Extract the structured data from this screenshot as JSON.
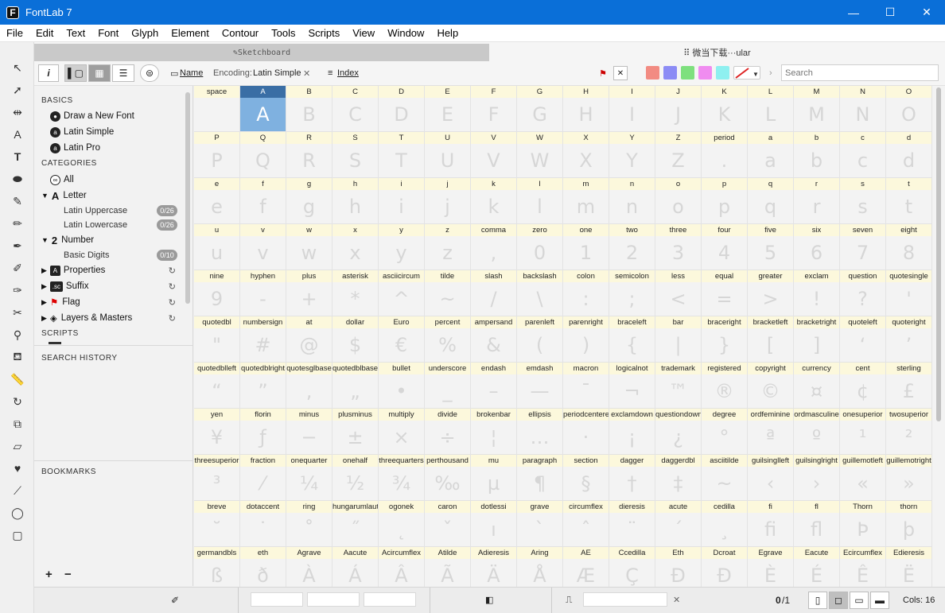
{
  "window": {
    "title": "FontLab 7",
    "controls": [
      "—",
      "☐",
      "✕"
    ]
  },
  "menu": [
    "File",
    "Edit",
    "Text",
    "Font",
    "Glyph",
    "Element",
    "Contour",
    "Tools",
    "Scripts",
    "View",
    "Window",
    "Help"
  ],
  "tabs": {
    "sketchboard": "✎Sketchboard",
    "font": "⠿ 微当下载···ular"
  },
  "toolbar": {
    "info": "i",
    "name_label": "Name",
    "encoding_label": "Encoding:",
    "encoding_value": "Latin Simple",
    "clear": "✕",
    "index_label": "Index",
    "search_placeholder": "Search",
    "color_swatches": [
      "#f28b82",
      "#8c8cf5",
      "#7ee07e",
      "#f08cf0",
      "#8ef0f0"
    ]
  },
  "sidebar": {
    "basics_header": "BASICS",
    "basics": [
      "Draw a New Font",
      "Latin Simple",
      "Latin Pro"
    ],
    "categories_header": "CATEGORIES",
    "all": "All",
    "letter": "Letter",
    "latin_upper": "Latin Uppercase",
    "latin_upper_badge": "0/26",
    "latin_lower": "Latin Lowercase",
    "latin_lower_badge": "0/26",
    "number": "Number",
    "basic_digits": "Basic Digits",
    "basic_digits_badge": "0/10",
    "properties": "Properties",
    "suffix": "Suffix",
    "flag": "Flag",
    "layers": "Layers & Masters",
    "scripts_header": "SCRIPTS",
    "search_history": "SEARCH HISTORY",
    "bookmarks": "BOOKMARKS",
    "add": "+",
    "remove": "−"
  },
  "status": {
    "count": "0",
    "total": "/1",
    "cols": "Cols: 16"
  },
  "glyph_rows": [
    [
      [
        "space",
        ""
      ],
      [
        "A",
        "A"
      ],
      [
        "B",
        "B"
      ],
      [
        "C",
        "C"
      ],
      [
        "D",
        "D"
      ],
      [
        "E",
        "E"
      ],
      [
        "F",
        "F"
      ],
      [
        "G",
        "G"
      ],
      [
        "H",
        "H"
      ],
      [
        "I",
        "I"
      ],
      [
        "J",
        "J"
      ],
      [
        "K",
        "K"
      ],
      [
        "L",
        "L"
      ],
      [
        "M",
        "M"
      ],
      [
        "N",
        "N"
      ],
      [
        "O",
        "O"
      ]
    ],
    [
      [
        "P",
        "P"
      ],
      [
        "Q",
        "Q"
      ],
      [
        "R",
        "R"
      ],
      [
        "S",
        "S"
      ],
      [
        "T",
        "T"
      ],
      [
        "U",
        "U"
      ],
      [
        "V",
        "V"
      ],
      [
        "W",
        "W"
      ],
      [
        "X",
        "X"
      ],
      [
        "Y",
        "Y"
      ],
      [
        "Z",
        "Z"
      ],
      [
        "period",
        "."
      ],
      [
        "a",
        "a"
      ],
      [
        "b",
        "b"
      ],
      [
        "c",
        "c"
      ],
      [
        "d",
        "d"
      ]
    ],
    [
      [
        "e",
        "e"
      ],
      [
        "f",
        "f"
      ],
      [
        "g",
        "g"
      ],
      [
        "h",
        "h"
      ],
      [
        "i",
        "i"
      ],
      [
        "j",
        "j"
      ],
      [
        "k",
        "k"
      ],
      [
        "l",
        "l"
      ],
      [
        "m",
        "m"
      ],
      [
        "n",
        "n"
      ],
      [
        "o",
        "o"
      ],
      [
        "p",
        "p"
      ],
      [
        "q",
        "q"
      ],
      [
        "r",
        "r"
      ],
      [
        "s",
        "s"
      ],
      [
        "t",
        "t"
      ]
    ],
    [
      [
        "u",
        "u"
      ],
      [
        "v",
        "v"
      ],
      [
        "w",
        "w"
      ],
      [
        "x",
        "x"
      ],
      [
        "y",
        "y"
      ],
      [
        "z",
        "z"
      ],
      [
        "comma",
        ","
      ],
      [
        "zero",
        "0"
      ],
      [
        "one",
        "1"
      ],
      [
        "two",
        "2"
      ],
      [
        "three",
        "3"
      ],
      [
        "four",
        "4"
      ],
      [
        "five",
        "5"
      ],
      [
        "six",
        "6"
      ],
      [
        "seven",
        "7"
      ],
      [
        "eight",
        "8"
      ]
    ],
    [
      [
        "nine",
        "9"
      ],
      [
        "hyphen",
        "-"
      ],
      [
        "plus",
        "+"
      ],
      [
        "asterisk",
        "*"
      ],
      [
        "asciicircum",
        "^"
      ],
      [
        "tilde",
        "~"
      ],
      [
        "slash",
        "/"
      ],
      [
        "backslash",
        "\\"
      ],
      [
        "colon",
        ":"
      ],
      [
        "semicolon",
        ";"
      ],
      [
        "less",
        "<"
      ],
      [
        "equal",
        "="
      ],
      [
        "greater",
        ">"
      ],
      [
        "exclam",
        "!"
      ],
      [
        "question",
        "?"
      ],
      [
        "quotesingle",
        "'"
      ]
    ],
    [
      [
        "quotedbl",
        "\""
      ],
      [
        "numbersign",
        "#"
      ],
      [
        "at",
        "@"
      ],
      [
        "dollar",
        "$"
      ],
      [
        "Euro",
        "€"
      ],
      [
        "percent",
        "%"
      ],
      [
        "ampersand",
        "&"
      ],
      [
        "parenleft",
        "("
      ],
      [
        "parenright",
        ")"
      ],
      [
        "braceleft",
        "{"
      ],
      [
        "bar",
        "|"
      ],
      [
        "braceright",
        "}"
      ],
      [
        "bracketleft",
        "["
      ],
      [
        "bracketright",
        "]"
      ],
      [
        "quoteleft",
        "‘"
      ],
      [
        "quoteright",
        "’"
      ]
    ],
    [
      [
        "quotedblleft",
        "“"
      ],
      [
        "quotedblright",
        "”"
      ],
      [
        "quotesglbase",
        "‚"
      ],
      [
        "quotedblbase",
        "„"
      ],
      [
        "bullet",
        "•"
      ],
      [
        "underscore",
        "_"
      ],
      [
        "endash",
        "–"
      ],
      [
        "emdash",
        "—"
      ],
      [
        "macron",
        "¯"
      ],
      [
        "logicalnot",
        "¬"
      ],
      [
        "trademark",
        "™"
      ],
      [
        "registered",
        "®"
      ],
      [
        "copyright",
        "©"
      ],
      [
        "currency",
        "¤"
      ],
      [
        "cent",
        "¢"
      ],
      [
        "sterling",
        "£"
      ]
    ],
    [
      [
        "yen",
        "¥"
      ],
      [
        "florin",
        "ƒ"
      ],
      [
        "minus",
        "−"
      ],
      [
        "plusminus",
        "±"
      ],
      [
        "multiply",
        "×"
      ],
      [
        "divide",
        "÷"
      ],
      [
        "brokenbar",
        "¦"
      ],
      [
        "ellipsis",
        "…"
      ],
      [
        "periodcentered",
        "·"
      ],
      [
        "exclamdown",
        "¡"
      ],
      [
        "questiondown",
        "¿"
      ],
      [
        "degree",
        "°"
      ],
      [
        "ordfeminine",
        "ª"
      ],
      [
        "ordmasculine",
        "º"
      ],
      [
        "onesuperior",
        "¹"
      ],
      [
        "twosuperior",
        "²"
      ]
    ],
    [
      [
        "threesuperior",
        "³"
      ],
      [
        "fraction",
        "⁄"
      ],
      [
        "onequarter",
        "¼"
      ],
      [
        "onehalf",
        "½"
      ],
      [
        "threequarters",
        "¾"
      ],
      [
        "perthousand",
        "‰"
      ],
      [
        "mu",
        "µ"
      ],
      [
        "paragraph",
        "¶"
      ],
      [
        "section",
        "§"
      ],
      [
        "dagger",
        "†"
      ],
      [
        "daggerdbl",
        "‡"
      ],
      [
        "asciitilde",
        "~"
      ],
      [
        "guilsinglleft",
        "‹"
      ],
      [
        "guilsinglright",
        "›"
      ],
      [
        "guillemotleft",
        "«"
      ],
      [
        "guillemotright",
        "»"
      ]
    ],
    [
      [
        "breve",
        "˘"
      ],
      [
        "dotaccent",
        "˙"
      ],
      [
        "ring",
        "˚"
      ],
      [
        "hungarumlaut",
        "˝"
      ],
      [
        "ogonek",
        "˛"
      ],
      [
        "caron",
        "ˇ"
      ],
      [
        "dotlessi",
        "ı"
      ],
      [
        "grave",
        "`"
      ],
      [
        "circumflex",
        "ˆ"
      ],
      [
        "dieresis",
        "¨"
      ],
      [
        "acute",
        "´"
      ],
      [
        "cedilla",
        "¸"
      ],
      [
        "fi",
        "fi"
      ],
      [
        "fl",
        "fl"
      ],
      [
        "Thorn",
        "Þ"
      ],
      [
        "thorn",
        "þ"
      ]
    ],
    [
      [
        "germandbls",
        "ß"
      ],
      [
        "eth",
        "ð"
      ],
      [
        "Agrave",
        "À"
      ],
      [
        "Aacute",
        "Á"
      ],
      [
        "Acircumflex",
        "Â"
      ],
      [
        "Atilde",
        "Ã"
      ],
      [
        "Adieresis",
        "Ä"
      ],
      [
        "Aring",
        "Å"
      ],
      [
        "AE",
        "Æ"
      ],
      [
        "Ccedilla",
        "Ç"
      ],
      [
        "Eth",
        "Ð"
      ],
      [
        "Dcroat",
        "Đ"
      ],
      [
        "Egrave",
        "È"
      ],
      [
        "Eacute",
        "É"
      ],
      [
        "Ecircumflex",
        "Ê"
      ],
      [
        "Edieresis",
        "Ë"
      ]
    ]
  ]
}
